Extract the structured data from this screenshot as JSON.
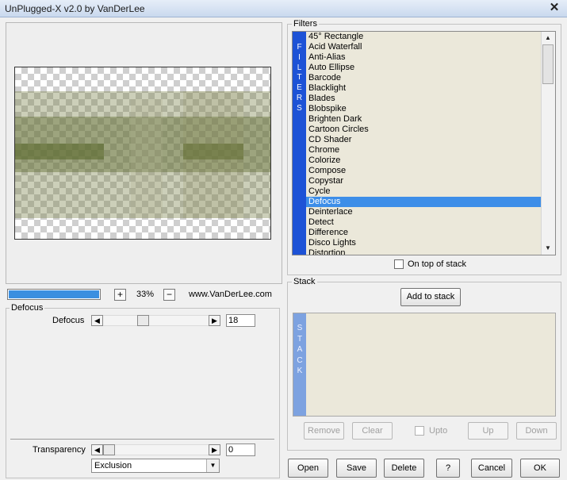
{
  "window": {
    "title": "UnPlugged-X v2.0 by VanDerLee",
    "close_glyph": "✕"
  },
  "preview": {
    "progress_percent": 100,
    "zoom_out_label": "+",
    "zoom_value": "33%",
    "zoom_in_label": "−",
    "website": "www.VanDerLee.com"
  },
  "defocus_group": {
    "legend": "Defocus",
    "defocus_label": "Defocus",
    "defocus_value": "18",
    "transparency_label": "Transparency",
    "transparency_value": "0",
    "blend_mode": "Exclusion"
  },
  "filters": {
    "legend": "Filters",
    "banner_letters": [
      "F",
      "I",
      "L",
      "T",
      "E",
      "R",
      "S"
    ],
    "items": [
      {
        "label": "45° Rectangle"
      },
      {
        "label": "Acid Waterfall"
      },
      {
        "label": "Anti-Alias"
      },
      {
        "label": "Auto Ellipse"
      },
      {
        "label": "Barcode"
      },
      {
        "label": "Blacklight"
      },
      {
        "label": "Blades"
      },
      {
        "label": "Blobspike"
      },
      {
        "label": "Brighten Dark"
      },
      {
        "label": "Cartoon Circles"
      },
      {
        "label": "CD Shader"
      },
      {
        "label": "Chrome"
      },
      {
        "label": "Colorize"
      },
      {
        "label": "Compose"
      },
      {
        "label": "Copystar"
      },
      {
        "label": "Cycle"
      },
      {
        "label": "Defocus"
      },
      {
        "label": "Deinterlace"
      },
      {
        "label": "Detect"
      },
      {
        "label": "Difference"
      },
      {
        "label": "Disco Lights"
      },
      {
        "label": "Distortion"
      }
    ],
    "selected_index": 16,
    "on_top_label": "On top of stack"
  },
  "stack": {
    "legend": "Stack",
    "add_label": "Add to stack",
    "banner_letters": [
      "S",
      "T",
      "A",
      "C",
      "K"
    ],
    "remove_label": "Remove",
    "clear_label": "Clear",
    "upto_label": "Upto",
    "up_label": "Up",
    "down_label": "Down"
  },
  "footer": {
    "open_label": "Open",
    "save_label": "Save",
    "delete_label": "Delete",
    "help_label": "?",
    "cancel_label": "Cancel",
    "ok_label": "OK"
  },
  "colors": {
    "accent_blue": "#1d52d6",
    "selection_blue": "#3d8ee8",
    "list_background": "#ebe8da",
    "preview_olive": "#6f7a3c"
  }
}
